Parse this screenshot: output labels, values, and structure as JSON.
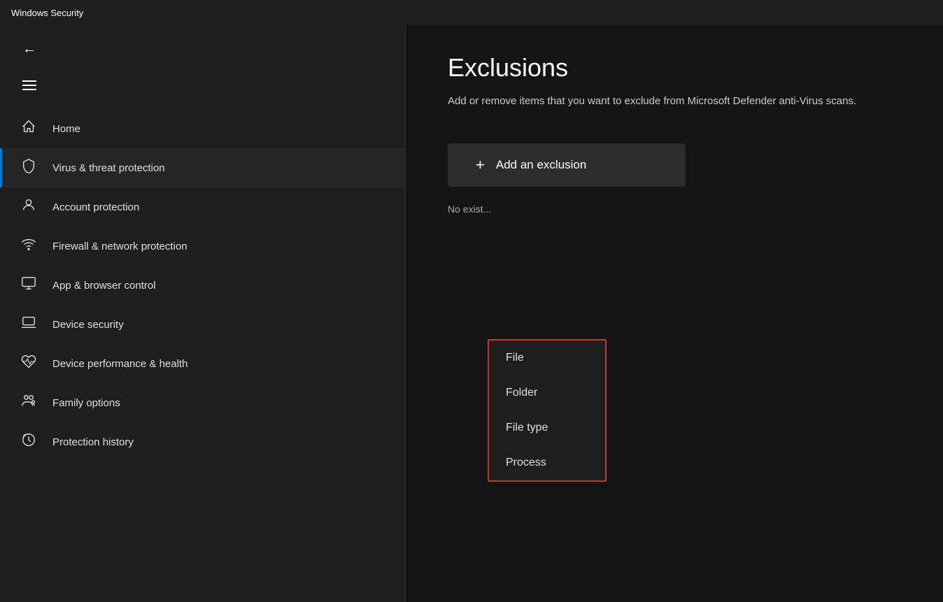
{
  "titleBar": {
    "label": "Windows Security"
  },
  "sidebar": {
    "navItems": [
      {
        "id": "home",
        "label": "Home",
        "icon": "⌂",
        "active": false
      },
      {
        "id": "virus-threat",
        "label": "Virus & threat protection",
        "icon": "🛡",
        "active": true
      },
      {
        "id": "account-protection",
        "label": "Account protection",
        "icon": "👤",
        "active": false
      },
      {
        "id": "firewall",
        "label": "Firewall & network protection",
        "icon": "📡",
        "active": false
      },
      {
        "id": "app-browser",
        "label": "App & browser control",
        "icon": "🖥",
        "active": false
      },
      {
        "id": "device-security",
        "label": "Device security",
        "icon": "💻",
        "active": false
      },
      {
        "id": "device-performance",
        "label": "Device performance & health",
        "icon": "💗",
        "active": false
      },
      {
        "id": "family-options",
        "label": "Family options",
        "icon": "👨‍👩‍👧",
        "active": false
      },
      {
        "id": "protection-history",
        "label": "Protection history",
        "icon": "🔄",
        "active": false
      }
    ]
  },
  "mainContent": {
    "title": "Exclusions",
    "description": "Add or remove items that you want to exclude from Microsoft Defender anti-Virus scans.",
    "addButton": {
      "label": "Add an exclusion",
      "plusIcon": "+"
    },
    "noExistingText": "No exist",
    "dropdown": {
      "items": [
        {
          "id": "file",
          "label": "File"
        },
        {
          "id": "folder",
          "label": "Folder"
        },
        {
          "id": "file-type",
          "label": "File type"
        },
        {
          "id": "process",
          "label": "Process"
        }
      ]
    }
  }
}
